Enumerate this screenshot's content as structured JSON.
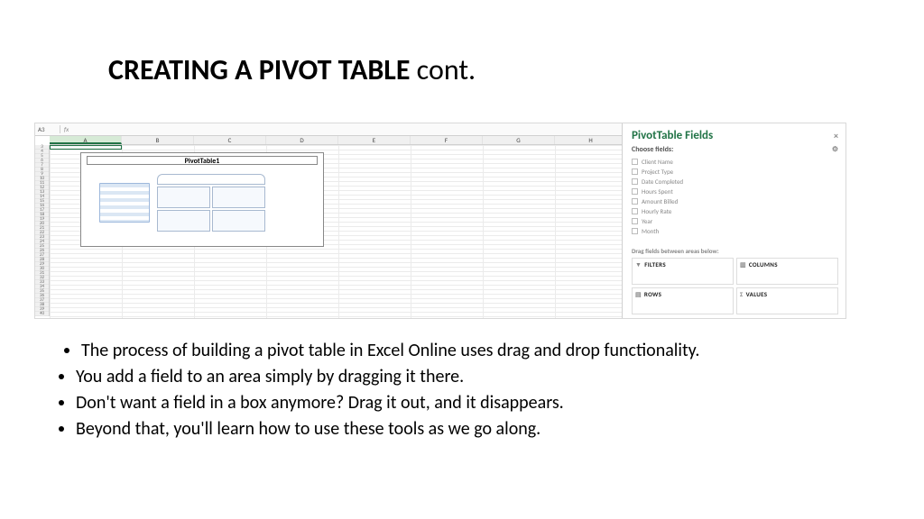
{
  "title": {
    "bold": "CREATING A PIVOT TABLE",
    "rest": " cont."
  },
  "excel": {
    "name_box": "A3",
    "fx": "fx",
    "columns": [
      "A",
      "B",
      "C",
      "D",
      "E",
      "F",
      "G",
      "H"
    ],
    "rows_start": 3,
    "rows_end": 40,
    "pivot_placeholder_title": "PivotTable1",
    "fields_pane": {
      "title": "PivotTable Fields",
      "close": "×",
      "choose": "Choose fields:",
      "gear": "⚙",
      "fields": [
        "Client Name",
        "Project Type",
        "Date Completed",
        "Hours Spent",
        "Amount Billed",
        "Hourly Rate",
        "Year",
        "Month"
      ],
      "drag_label": "Drag fields between areas below:",
      "areas": {
        "filters": "FILTERS",
        "columns": "COLUMNS",
        "rows": "ROWS",
        "values": "VALUES"
      }
    }
  },
  "bullets": [
    "The process of building a pivot table in Excel Online uses drag and drop functionality.",
    "You add a field to an area simply by dragging it there.",
    "Don't want a field in a box anymore? Drag it out, and it disappears.",
    "Beyond that, you'll learn how to use these tools as we go along."
  ]
}
